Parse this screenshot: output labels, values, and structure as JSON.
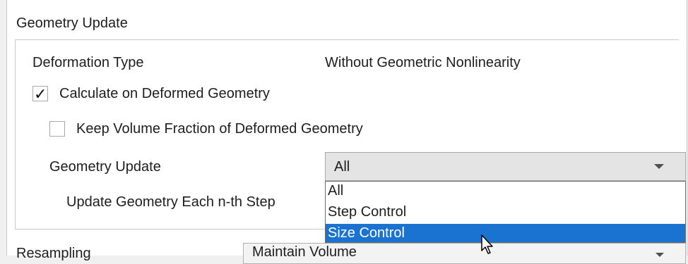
{
  "section": {
    "title": "Geometry Update"
  },
  "deformation": {
    "label": "Deformation Type",
    "value": "Without Geometric Nonlinearity"
  },
  "calc_deformed": {
    "label": "Calculate on Deformed Geometry",
    "checked": true
  },
  "keep_volume": {
    "label": "Keep Volume Fraction of Deformed Geometry",
    "checked": false
  },
  "geometry_update": {
    "label": "Geometry Update",
    "selected": "All",
    "options": [
      "All",
      "Step Control",
      "Size Control"
    ],
    "highlighted_option": "Size Control"
  },
  "update_each": {
    "label": "Update Geometry Each n-th Step"
  },
  "resampling": {
    "label": "Resampling",
    "value": "Maintain Volume"
  },
  "colors": {
    "highlight": "#1a73d0",
    "combo_bg": "#e4e4e4"
  }
}
